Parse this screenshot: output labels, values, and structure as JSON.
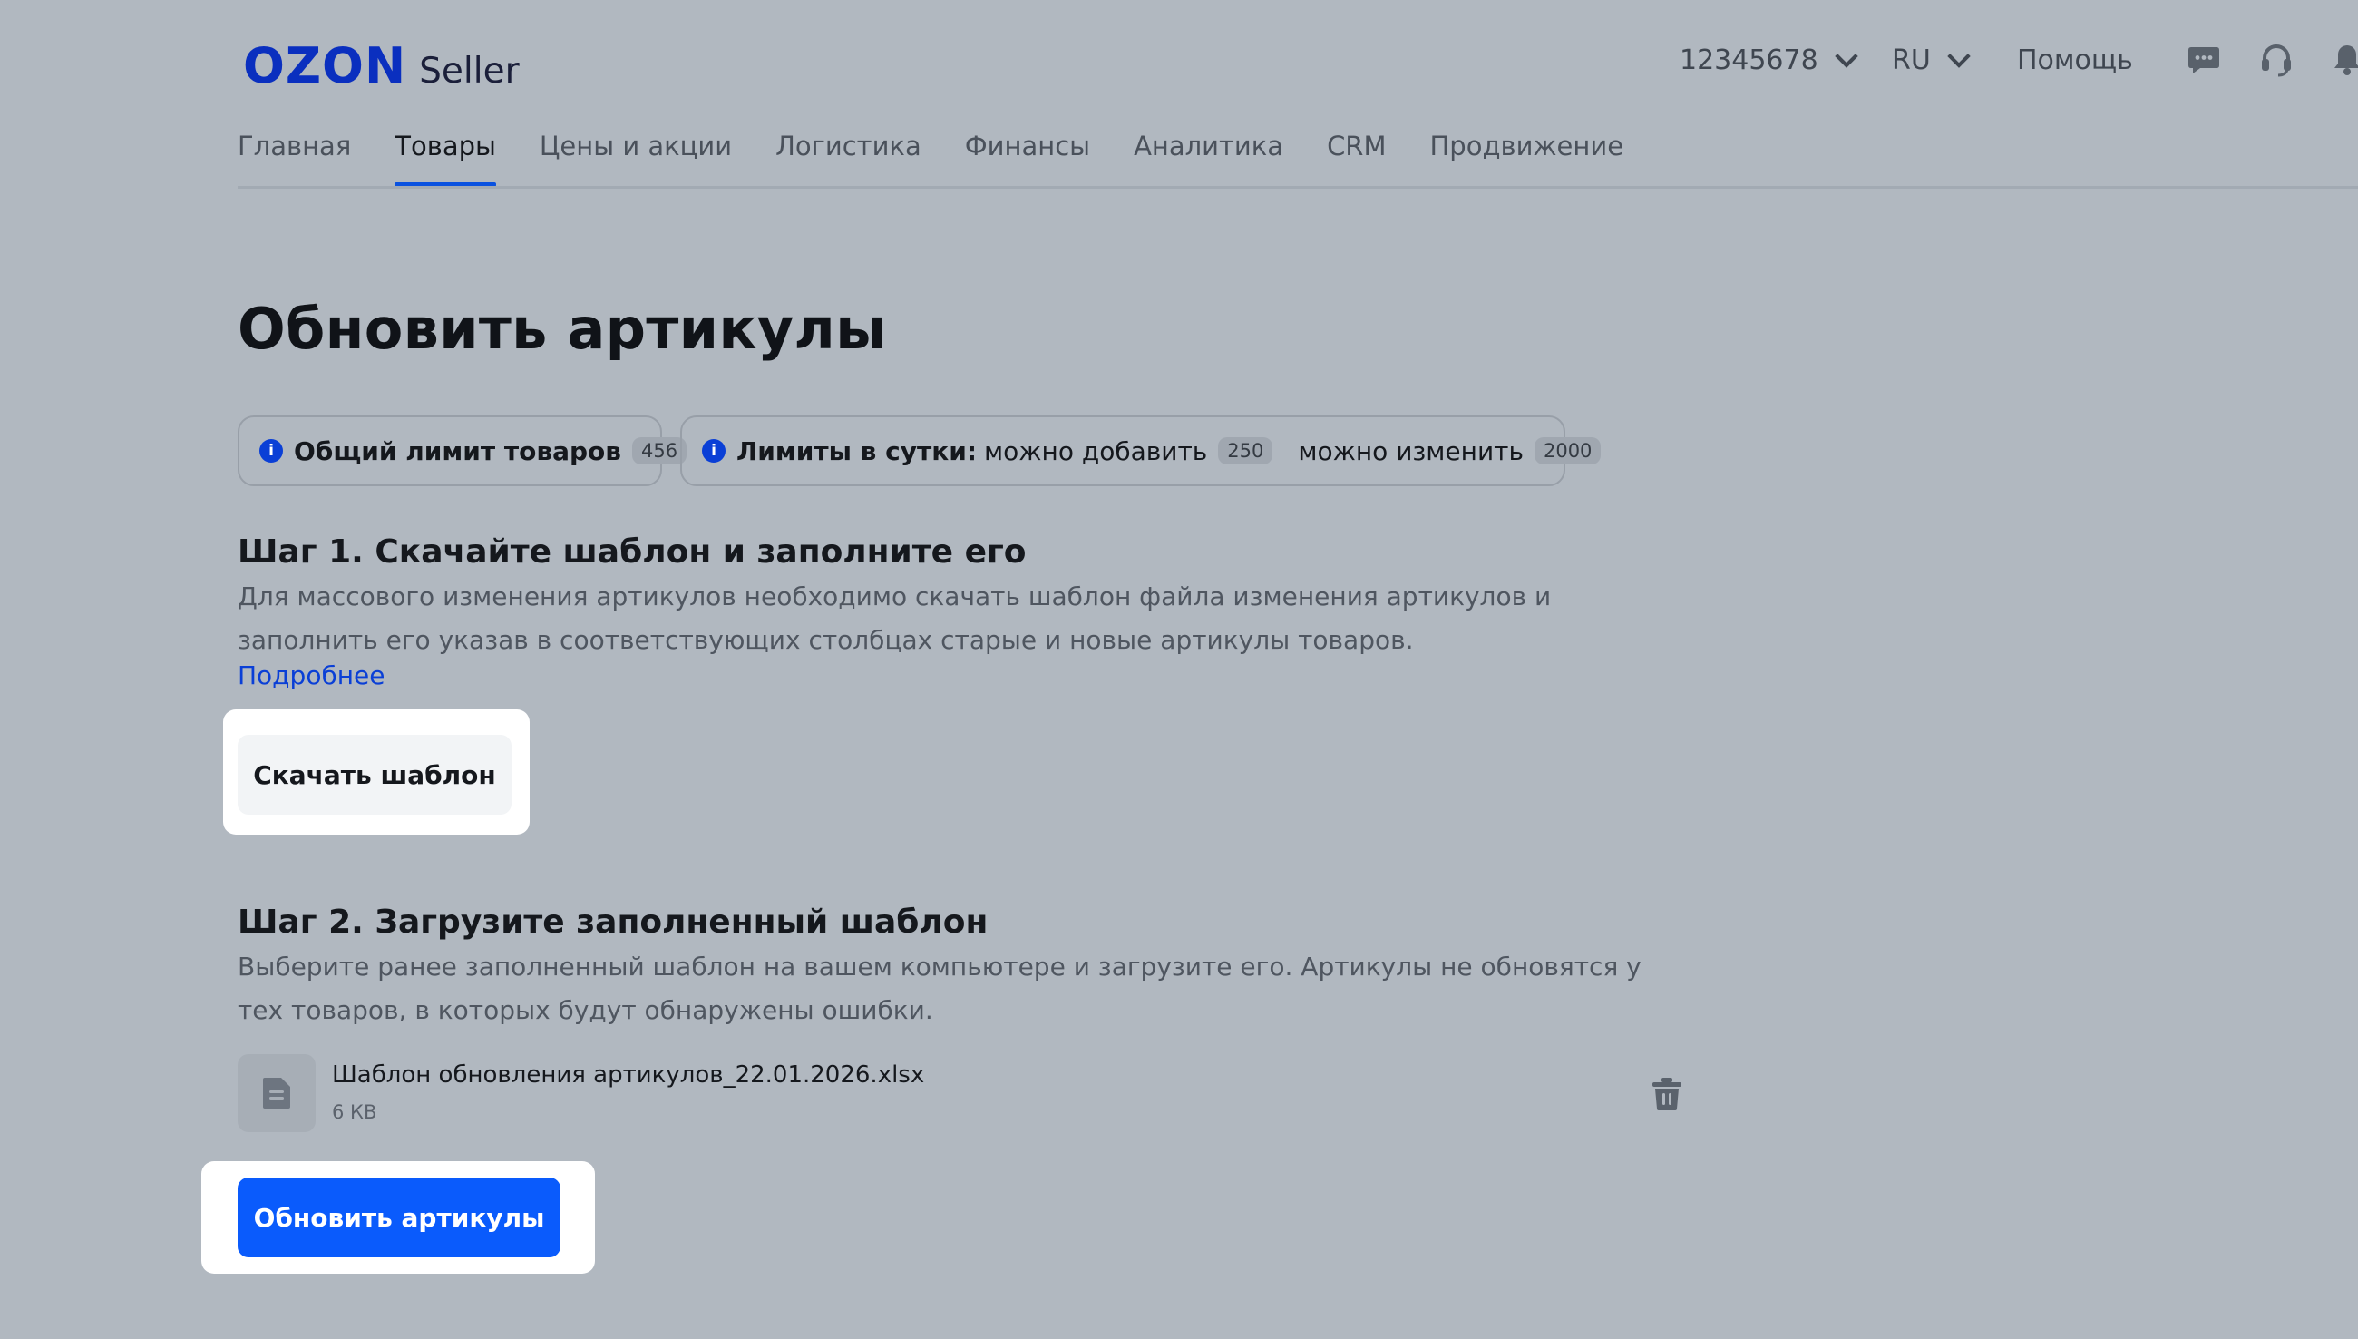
{
  "header": {
    "logo_brand": "OZON",
    "logo_product": "Seller",
    "account_id": "12345678",
    "language": "RU",
    "help": "Помощь",
    "icons": [
      "chat-icon",
      "headset-icon",
      "bell-icon"
    ]
  },
  "nav": {
    "items": [
      "Главная",
      "Товары",
      "Цены и акции",
      "Логистика",
      "Финансы",
      "Аналитика",
      "CRM",
      "Продвижение"
    ],
    "active": "Товары"
  },
  "page": {
    "title": "Обновить артикулы"
  },
  "limits": {
    "total_label": "Общий лимит товаров",
    "total_count": "456",
    "daily_label": "Лимиты в сутки:",
    "can_add_label": "можно добавить",
    "can_add_count": "250",
    "can_edit_label": "можно изменить",
    "can_edit_count": "2000"
  },
  "step1": {
    "title": "Шаг 1. Скачайте шаблон и заполните его",
    "description": "Для массового изменения артикулов необходимо скачать шаблон файла изменения артикулов и заполнить его указав в соответствующих столбцах старые и новые артикулы товаров.",
    "more_link": "Подробнее",
    "download_button": "Скачать шаблон"
  },
  "step2": {
    "title": "Шаг 2. Загрузите заполненный шаблон",
    "description": "Выберите ранее заполненный шаблон на вашем компьютере и загрузите его. Артикулы не обновятся у тех товаров, в которых будут обнаружены ошибки.",
    "file": {
      "name": "Шаблон обновления артикулов_22.01.2026.xlsx",
      "size": "6 КВ"
    },
    "update_button": "Обновить артикулы"
  },
  "colors": {
    "background": "#b1b8c0",
    "brand_blue": "#0a2fbf",
    "primary_button": "#0a5bfc",
    "link": "#0a3fd6"
  }
}
